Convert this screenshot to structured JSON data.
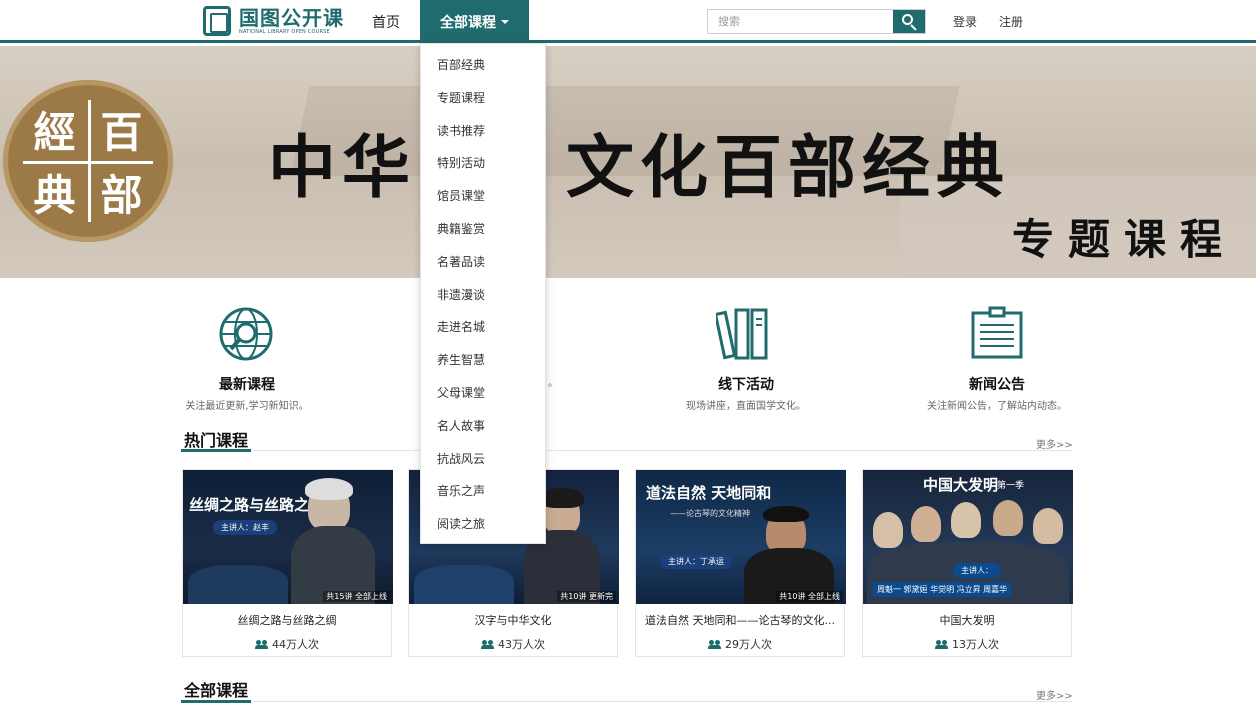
{
  "header": {
    "logo_cn": "国图公开课",
    "logo_en": "NATIONAL LIBRARY OPEN COURSE",
    "nav_home": "首页",
    "nav_all": "全部课程",
    "search_placeholder": "搜索",
    "login": "登录",
    "register": "注册"
  },
  "dropdown": {
    "items": [
      "百部经典",
      "专题课程",
      "读书推荐",
      "特别活动",
      "馆员课堂",
      "典籍鉴赏",
      "名著品读",
      "非遗漫谈",
      "走进名城",
      "养生智慧",
      "父母课堂",
      "名人故事",
      "抗战风云",
      "音乐之声",
      "阅读之旅"
    ]
  },
  "banner": {
    "title_visible": "中华",
    "title_rest": "文化百部经典",
    "subtitle": "专题课程",
    "seal_chars": [
      "經",
      "百",
      "典",
      "部"
    ],
    "slide_count": 4,
    "active_slide": 4
  },
  "features": [
    {
      "title": "最新课程",
      "desc": "关注最近更新,学习新知识。",
      "icon": "globe-search-icon"
    },
    {
      "title": "",
      "desc": "。",
      "icon": "hidden-icon"
    },
    {
      "title": "线下活动",
      "desc": "现场讲座，直面国学文化。",
      "icon": "books-icon"
    },
    {
      "title": "新闻公告",
      "desc": "关注新闻公告，了解站内动态。",
      "icon": "news-board-icon"
    }
  ],
  "hot": {
    "title": "热门课程",
    "more": "更多>>"
  },
  "courses": [
    {
      "title": "丝绸之路与丝路之绸",
      "views": "44万人次",
      "thumb_title": "丝绸之路与丝路之绸",
      "lecturer": "主讲人：赵丰",
      "badge": "共15讲 全部上线"
    },
    {
      "title": "汉字与中华文化",
      "views": "43万人次",
      "thumb_title": "",
      "lecturer": "",
      "badge": "共10讲 更新完"
    },
    {
      "title": "道法自然 天地同和——论古琴的文化...",
      "views": "29万人次",
      "thumb_title": "道法自然  天地同和",
      "thumb_sub": "——论古琴的文化精神",
      "lecturer": "主讲人：丁承运",
      "badge": "共10讲 全部上线"
    },
    {
      "title": "中国大发明",
      "views": "13万人次",
      "thumb_title": "中国大发明",
      "thumb_sub": "第一季",
      "lecturer": "主讲人：",
      "names": "周魁一 郭黛姮 华觉明 冯立昇 周嘉华",
      "badge": ""
    }
  ],
  "all": {
    "title": "全部课程",
    "more": "更多>>"
  },
  "colors": {
    "brand": "#1f6b6d"
  }
}
